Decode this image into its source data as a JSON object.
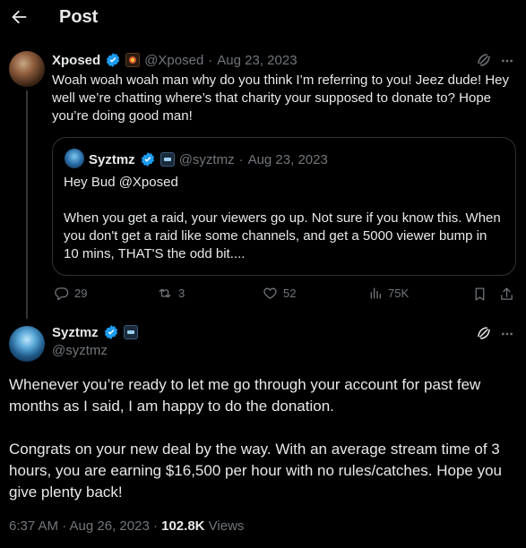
{
  "header": {
    "title": "Post"
  },
  "reply": {
    "name": "Xposed",
    "handle": "@Xposed",
    "date": "Aug 23, 2023",
    "text": "Woah woah woah man why do you think I’m referring to you! Jeez dude! Hey well we’re chatting where’s that charity your supposed to donate to? Hope you’re doing good man!",
    "quote": {
      "name": "Syztmz",
      "handle": "@syztmz",
      "date": "Aug 23, 2023",
      "line1": "Hey Bud @Xposed",
      "line2": "When you get a raid, your viewers go up. Not sure if you know this. When you don't get a raid like some channels, and get a 5000 viewer bump in 10 mins, THAT'S the odd bit...."
    },
    "stats": {
      "replies": "29",
      "reposts": "3",
      "likes": "52",
      "views": "75K"
    }
  },
  "main": {
    "name": "Syztmz",
    "handle": "@syztmz",
    "para1": "Whenever you’re ready to let me go through your account for past few months as I said, I am happy to do the donation.",
    "para2": "Congrats on your new deal by the way. With an average stream time of 3 hours, you are earning $16,500 per hour with no rules/catches. Hope you give plenty back!",
    "time": "6:37 AM · Aug 26, 2023 · ",
    "views_count": "102.8K",
    "views_label": " Views"
  },
  "colors": {
    "accent": "#1d9bf0",
    "background": "#000000",
    "muted": "#71767b",
    "border": "#2f3336"
  },
  "icons": [
    "back-arrow-icon",
    "verified-icon",
    "grok-icon",
    "more-icon",
    "reply-icon",
    "repost-icon",
    "like-icon",
    "views-icon",
    "bookmark-icon",
    "share-icon"
  ]
}
